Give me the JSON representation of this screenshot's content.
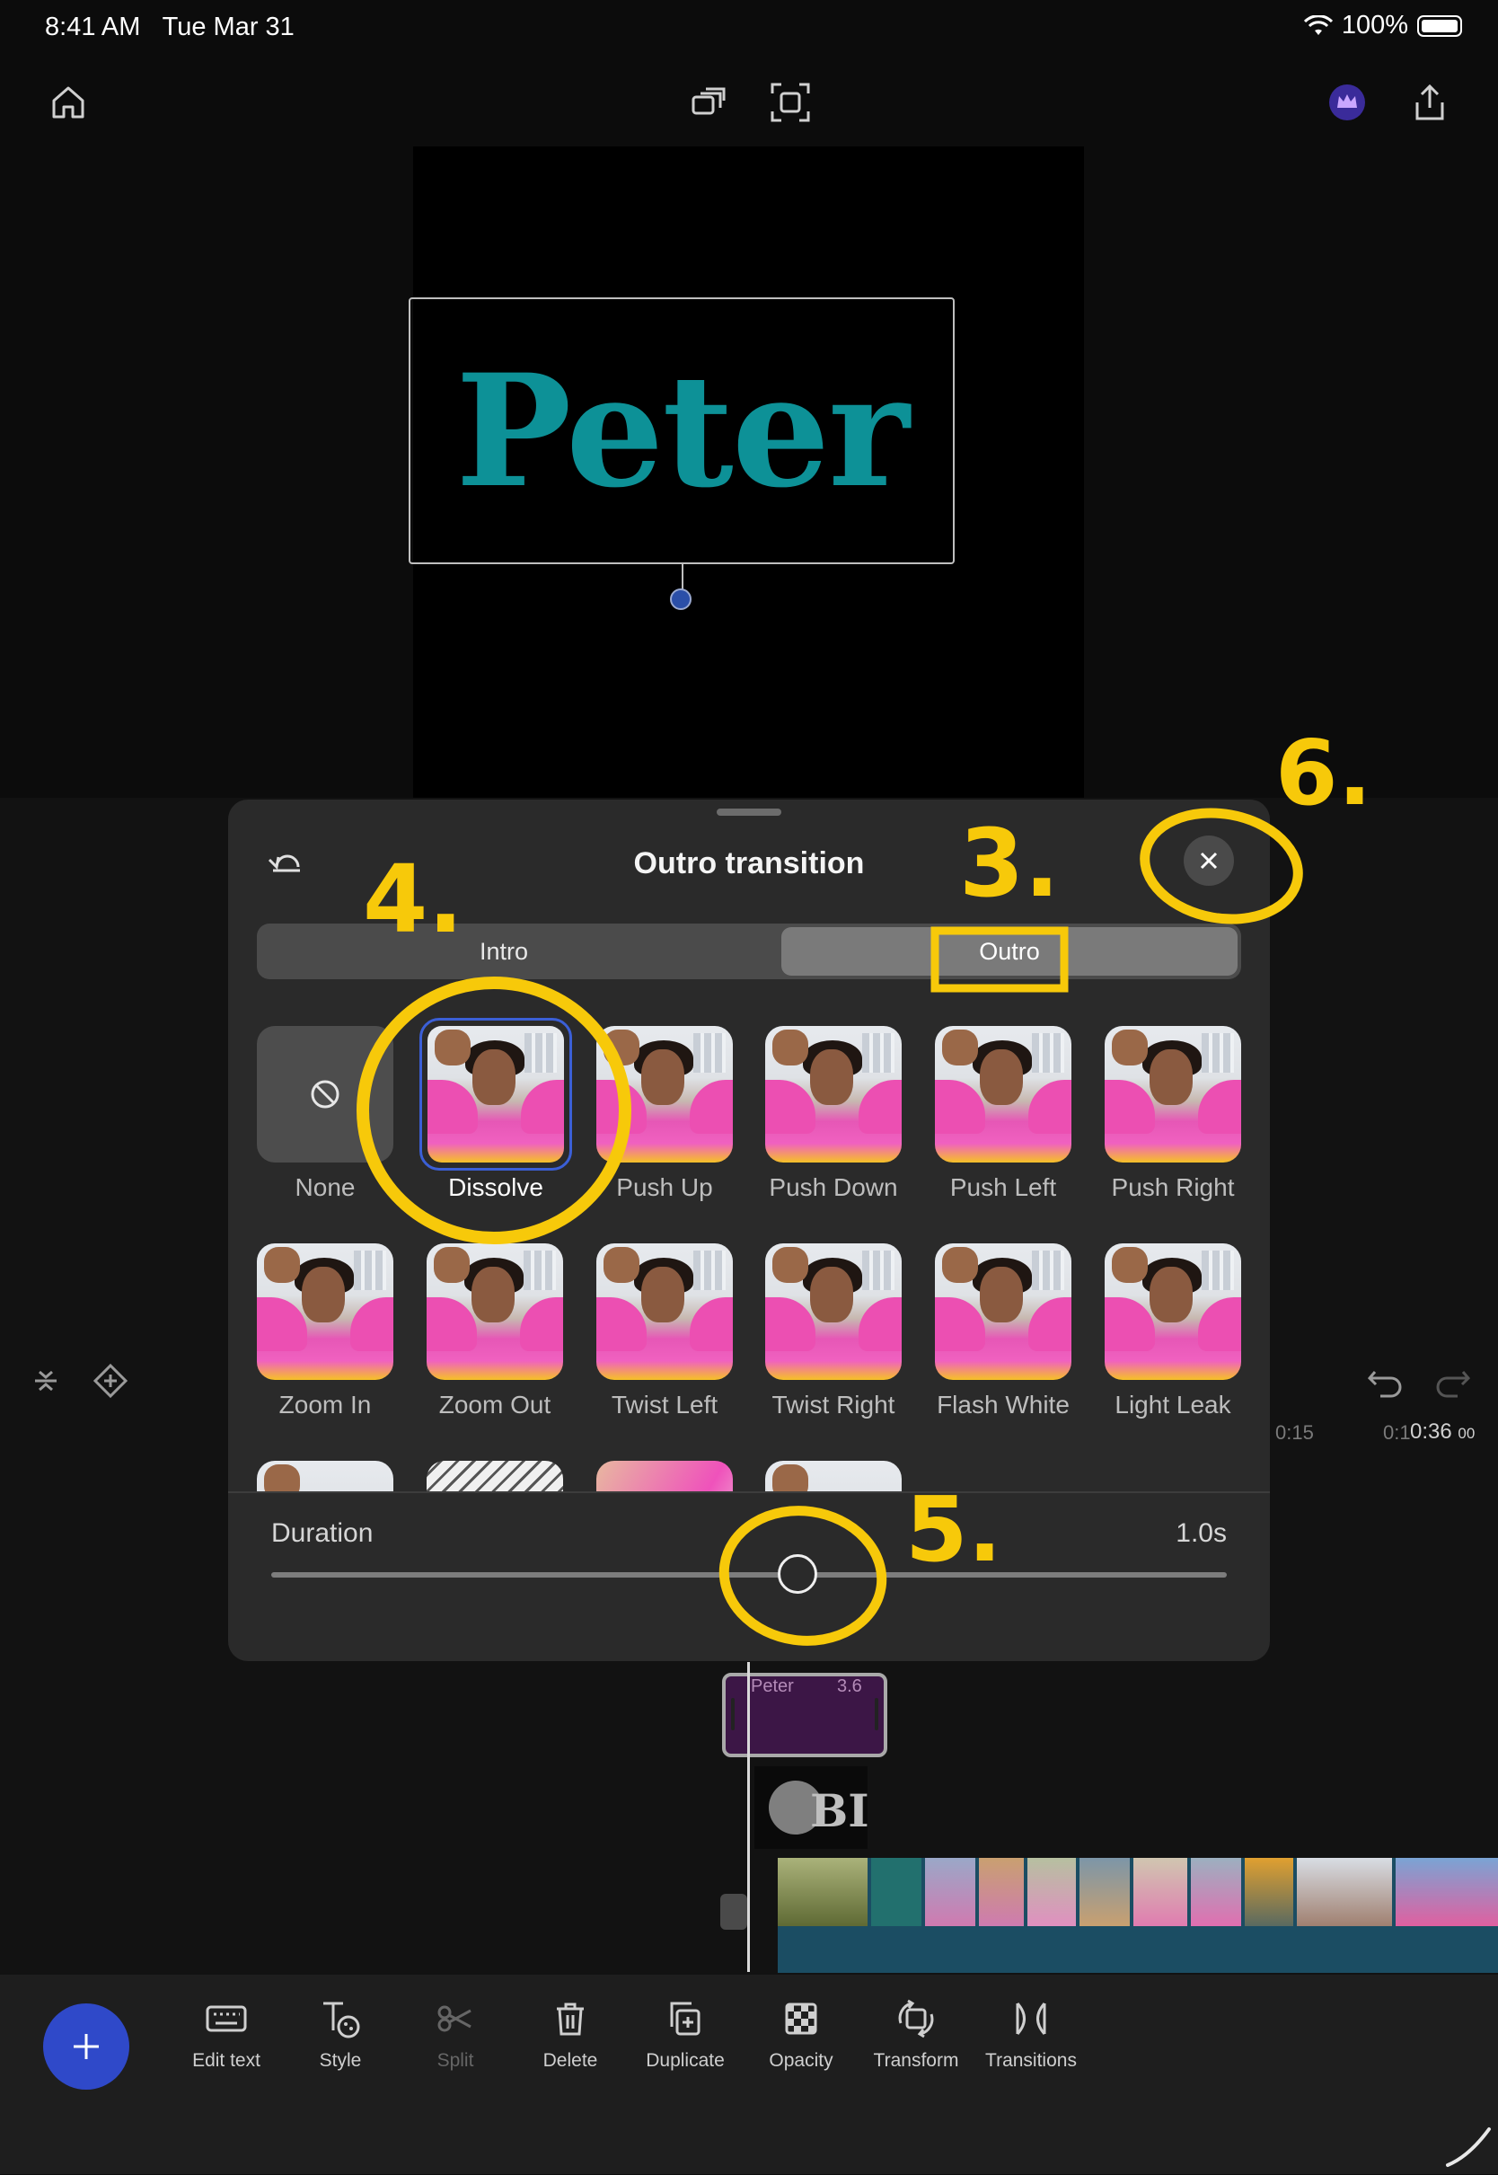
{
  "status_bar": {
    "time": "8:41 AM",
    "date": "Tue Mar 31",
    "battery": "100%"
  },
  "preview": {
    "title_text": "Peter"
  },
  "sheet": {
    "title": "Outro transition",
    "tabs": {
      "intro": "Intro",
      "outro": "Outro"
    },
    "transitions": [
      {
        "label": "None"
      },
      {
        "label": "Dissolve",
        "selected": true
      },
      {
        "label": "Push Up"
      },
      {
        "label": "Push Down"
      },
      {
        "label": "Push Left"
      },
      {
        "label": "Push Right"
      },
      {
        "label": "Zoom In"
      },
      {
        "label": "Zoom Out"
      },
      {
        "label": "Twist Left"
      },
      {
        "label": "Twist Right"
      },
      {
        "label": "Flash White"
      },
      {
        "label": "Light Leak"
      }
    ],
    "duration_label": "Duration",
    "duration_value": "1.0s",
    "duration_fraction": 0.55
  },
  "timeline": {
    "time_a": "0:15",
    "time_b": "0:1",
    "time_c": "0:36",
    "time_c_frames": "00",
    "clip_name": "Peter",
    "clip_duration": "3.6",
    "logo_text": "BI"
  },
  "toolbar": {
    "items": [
      "Edit text",
      "Style",
      "Split",
      "Delete",
      "Duplicate",
      "Opacity",
      "Transform",
      "Transitions"
    ]
  },
  "annotations": {
    "n3": "3.",
    "n4": "4.",
    "n5": "5.",
    "n6": "6."
  },
  "colors": {
    "accent": "#2f49c9",
    "annotation": "#f7c90a",
    "title_teal": "#0d9197",
    "selection": "#3b5fd6"
  }
}
